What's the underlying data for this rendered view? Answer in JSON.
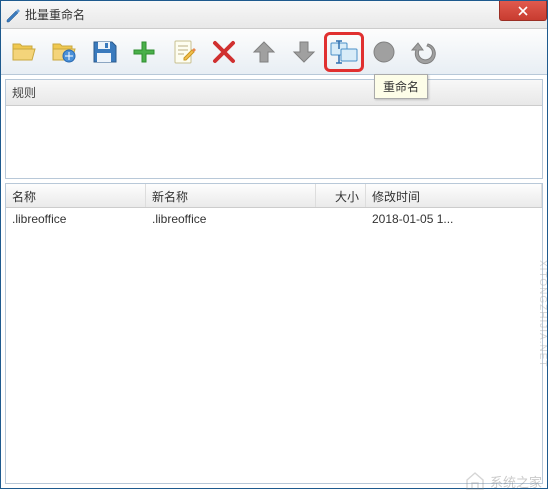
{
  "window": {
    "title": "批量重命名"
  },
  "toolbar": {
    "tooltip_rename": "重命名"
  },
  "rules": {
    "header": "规则"
  },
  "file_table": {
    "headers": {
      "name": "名称",
      "newname": "新名称",
      "size": "大小",
      "time": "修改时间"
    },
    "rows": [
      {
        "name": ".libreoffice",
        "newname": ".libreoffice",
        "size": "",
        "time": "2018-01-05  1..."
      }
    ]
  },
  "watermark": {
    "text": "系统之家",
    "url": "XITONGZHIJIA.NET"
  }
}
